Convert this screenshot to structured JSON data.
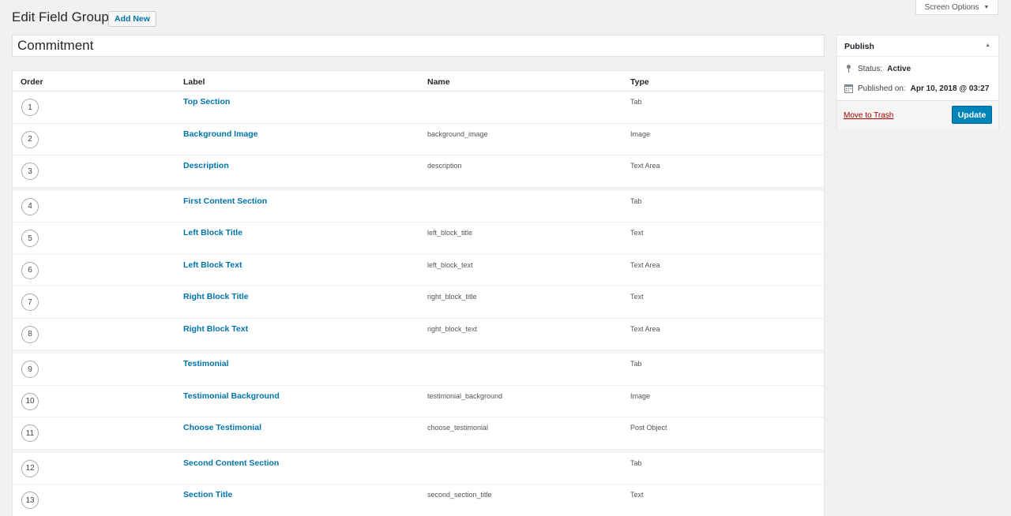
{
  "screen_options": {
    "label": "Screen Options",
    "caret_icon": "caret-down-icon"
  },
  "header": {
    "title": "Edit Field Group",
    "add_new_label": "Add New"
  },
  "title_input": {
    "value": "Commitment"
  },
  "table": {
    "columns": {
      "order": "Order",
      "label": "Label",
      "name": "Name",
      "type": "Type"
    },
    "rows": [
      {
        "order": "1",
        "label": "Top Section",
        "name": "",
        "type": "Tab"
      },
      {
        "order": "2",
        "label": "Background Image",
        "name": "background_image",
        "type": "Image"
      },
      {
        "order": "3",
        "label": "Description",
        "name": "description",
        "type": "Text Area"
      },
      {
        "order": "4",
        "label": "First Content Section",
        "name": "",
        "type": "Tab"
      },
      {
        "order": "5",
        "label": "Left Block Title",
        "name": "left_block_title",
        "type": "Text"
      },
      {
        "order": "6",
        "label": "Left Block Text",
        "name": "left_block_text",
        "type": "Text Area"
      },
      {
        "order": "7",
        "label": "Right Block Title",
        "name": "right_block_title",
        "type": "Text"
      },
      {
        "order": "8",
        "label": "Right Block Text",
        "name": "right_block_text",
        "type": "Text Area"
      },
      {
        "order": "9",
        "label": "Testimonial",
        "name": "",
        "type": "Tab"
      },
      {
        "order": "10",
        "label": "Testimonial Background",
        "name": "testimonial_background",
        "type": "Image"
      },
      {
        "order": "11",
        "label": "Choose Testimonial",
        "name": "choose_testimonial",
        "type": "Post Object"
      },
      {
        "order": "12",
        "label": "Second Content Section",
        "name": "",
        "type": "Tab"
      },
      {
        "order": "13",
        "label": "Section Title",
        "name": "second_section_title",
        "type": "Text"
      }
    ]
  },
  "publish": {
    "title": "Publish",
    "status_label": "Status:",
    "status_value": "Active",
    "published_label": "Published on:",
    "published_value": "Apr 10, 2018 @ 03:27",
    "trash_label": "Move to Trash",
    "update_label": "Update",
    "icons": {
      "status": "pin-icon",
      "published": "calendar-icon",
      "toggle": "caret-up-icon"
    },
    "colors": {
      "update_button": "#0085ba",
      "trash_link": "#a00"
    }
  }
}
